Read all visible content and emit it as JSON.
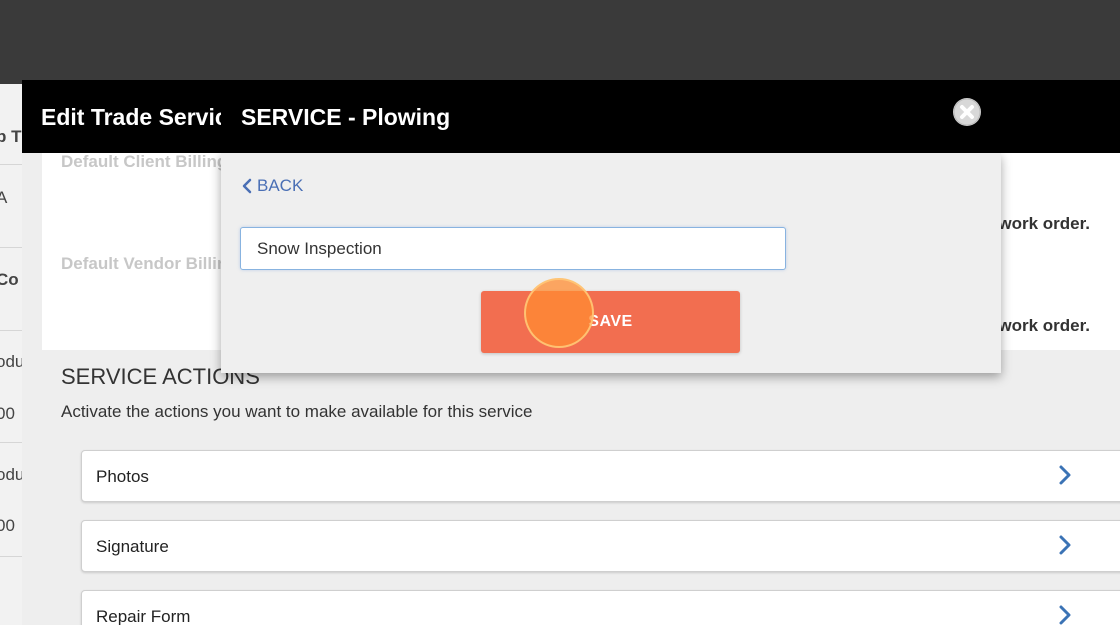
{
  "background_page": {
    "fragments": [
      "b T",
      "A",
      "Co",
      "odu",
      "00",
      "odu",
      "00"
    ]
  },
  "modal": {
    "title": "Edit Trade Service",
    "fields": [
      {
        "label": "Default Client Billing",
        "note": "work order."
      },
      {
        "label": "Default Vendor Billing",
        "note": "work order."
      }
    ],
    "actions_section": {
      "title": "SERVICE ACTIONS",
      "description": "Activate the actions you want to make available for this service",
      "items": [
        {
          "label": "Photos",
          "icon": "chevron-right-icon"
        },
        {
          "label": "Signature",
          "icon": "chevron-right-icon"
        },
        {
          "label": "Repair Form",
          "icon": "chevron-right-icon"
        }
      ]
    }
  },
  "sub_dialog": {
    "title": "SERVICE - Plowing",
    "back_label": "BACK",
    "name_input": {
      "value": "Snow Inspection",
      "placeholder": ""
    },
    "save_label": "SAVE",
    "close_icon": "close-icon"
  },
  "colors": {
    "header_bg": "#000000",
    "accent_link": "#4a6fb5",
    "save_button": "#f26e50",
    "chevron": "#3b73b5"
  }
}
